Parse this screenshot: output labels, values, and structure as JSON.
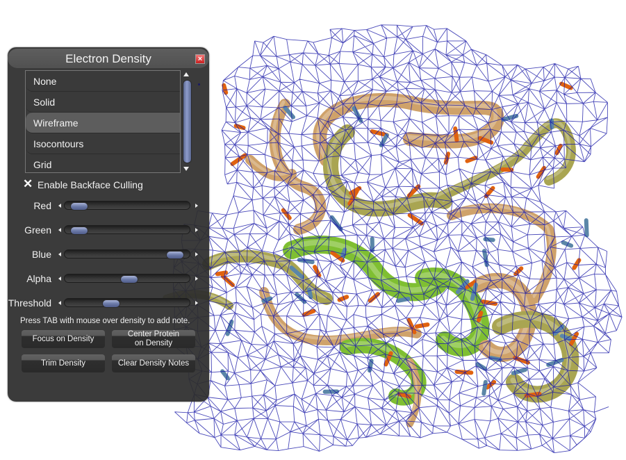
{
  "panel": {
    "title": "Electron Density",
    "close_icon": "close-icon",
    "render_modes": {
      "items": [
        "None",
        "Solid",
        "Wireframe",
        "Isocontours",
        "Grid"
      ],
      "selected": "Wireframe"
    },
    "backface_culling": {
      "label": "Enable Backface Culling",
      "checked": true
    },
    "sliders": [
      {
        "label": "Red",
        "value_fraction": 0.05
      },
      {
        "label": "Green",
        "value_fraction": 0.05
      },
      {
        "label": "Blue",
        "value_fraction": 0.95
      },
      {
        "label": "Alpha",
        "value_fraction": 0.52
      },
      {
        "label": "Threshold",
        "value_fraction": 0.35
      }
    ],
    "hint": "Press TAB with mouse over density to add note.",
    "buttons": {
      "focus": "Focus on Density",
      "center_line1": "Center Protein",
      "center_line2": "on Density",
      "trim": "Trim Density",
      "clear_notes": "Clear Density Notes"
    }
  },
  "scene": {
    "description": "protein backbone ribbons inside electron density wireframe mesh",
    "colors": {
      "background": "#ffffff",
      "mesh": "#1a1aa8",
      "ribbon_tan": "#cfa26a",
      "ribbon_olive": "#a9a552",
      "ribbon_green": "#7fbf32",
      "sidechain_orange": "#e0620f",
      "sidechain_blue": "#5b86a8"
    }
  }
}
